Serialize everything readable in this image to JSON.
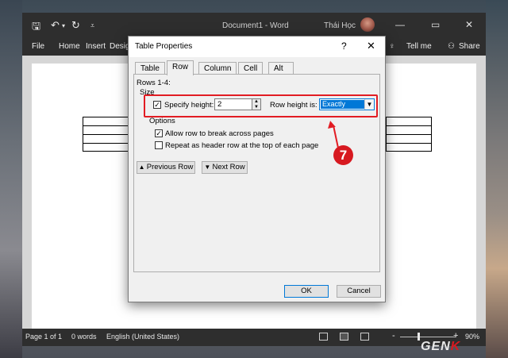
{
  "app": {
    "document_title": "Document1  -  Word",
    "user_name": "Thái Học"
  },
  "ribbon": {
    "file": "File",
    "home": "Home",
    "insert": "Insert",
    "design": "Desig",
    "tell_me": "Tell me",
    "share": "Share"
  },
  "dialog": {
    "title": "Table Properties",
    "help": "?",
    "close": "✕",
    "tabs": [
      {
        "label": "Table",
        "active": false
      },
      {
        "label": "Row",
        "active": true
      },
      {
        "label": "Column",
        "active": false
      },
      {
        "label": "Cell",
        "active": false
      },
      {
        "label": "Alt Text",
        "active": false
      }
    ],
    "rows_label": "Rows 1-4:",
    "size_label": "Size",
    "specify_height": {
      "label": "Specify height:",
      "checked": true,
      "value": "2"
    },
    "row_height_is": {
      "label": "Row height is:",
      "selected": "Exactly"
    },
    "options_label": "Options",
    "allow_break": {
      "label": "Allow row to break across pages",
      "checked": true
    },
    "repeat_header": {
      "label": "Repeat as header row at the top of each page",
      "checked": false
    },
    "previous_row": "Previous Row",
    "next_row": "Next Row",
    "ok": "OK",
    "cancel": "Cancel"
  },
  "status": {
    "page": "Page 1 of 1",
    "words": "0 words",
    "language": "English (United States)",
    "zoom": "90%",
    "zoom_minus": "-",
    "zoom_plus": "+"
  },
  "annotation": {
    "step": "7",
    "color": "#e21c23"
  },
  "watermark": {
    "logo_text": "GENK"
  },
  "colors": {
    "accent": "#0078d7",
    "titlebar": "#2e2e2e"
  }
}
